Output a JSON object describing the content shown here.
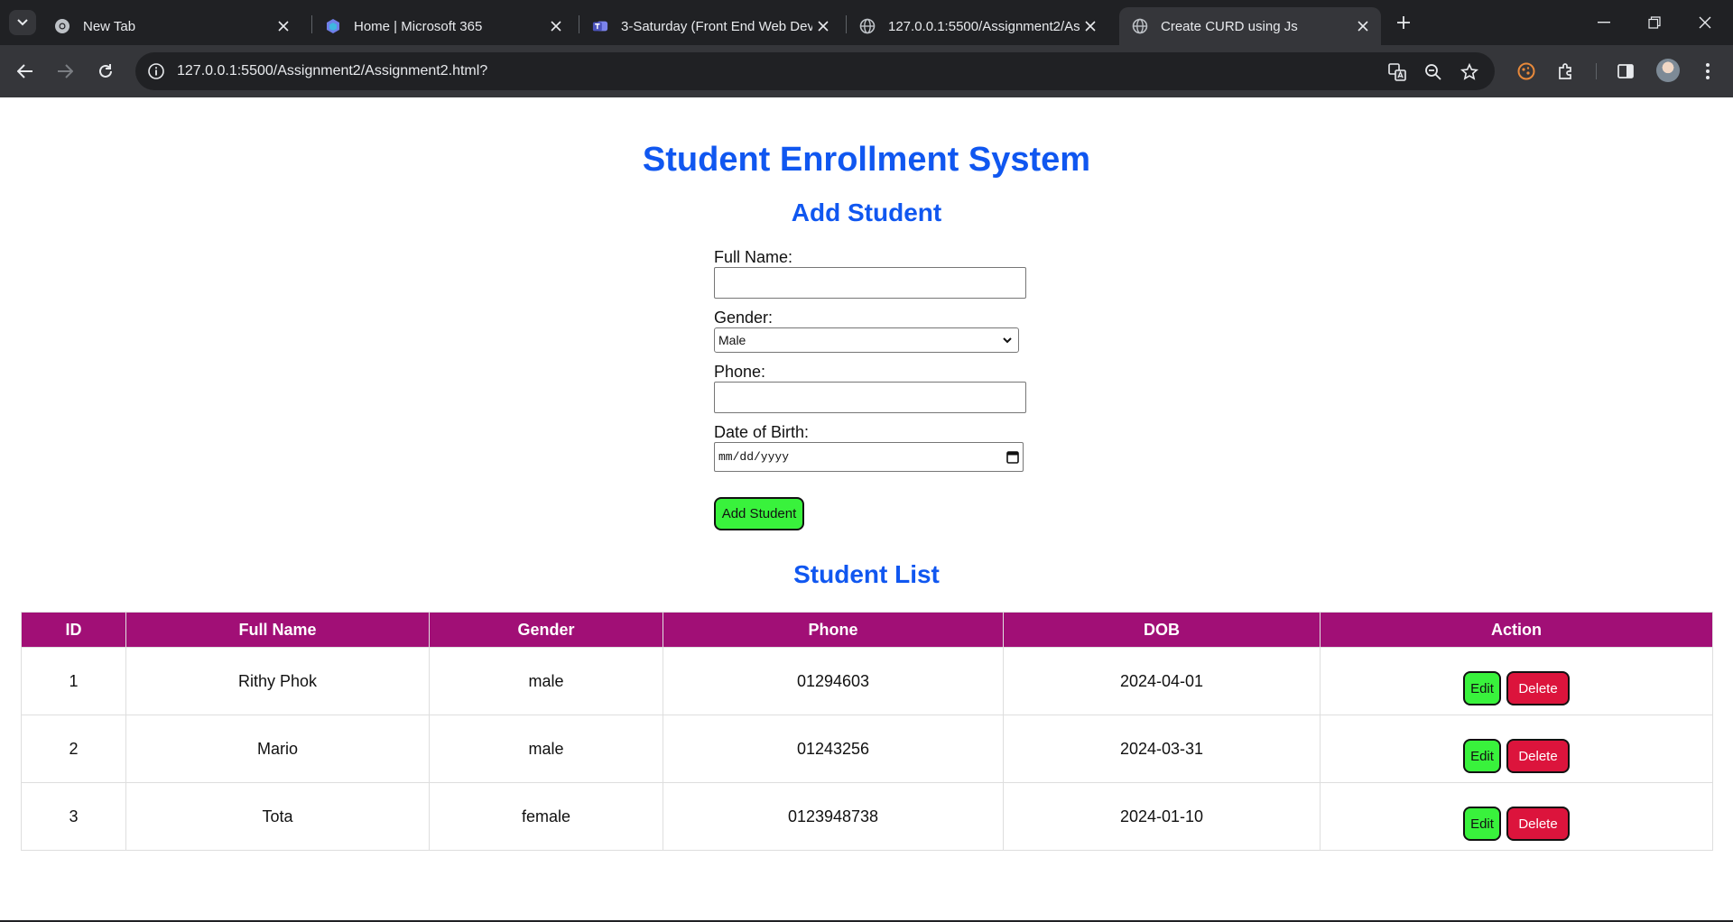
{
  "browser": {
    "tabs": [
      {
        "title": "New Tab",
        "favicon": "chrome-icon"
      },
      {
        "title": "Home | Microsoft 365",
        "favicon": "microsoft365-icon"
      },
      {
        "title": "3-Saturday (Front End Web Dev",
        "favicon": "teams-icon"
      },
      {
        "title": "127.0.0.1:5500/Assignment2/As",
        "favicon": "globe-icon"
      },
      {
        "title": "Create CURD using Js",
        "favicon": "globe-icon",
        "active": true
      }
    ],
    "url": "127.0.0.1:5500/Assignment2/Assignment2.html?"
  },
  "page": {
    "title": "Student Enrollment System",
    "form": {
      "heading": "Add Student",
      "full_name_label": "Full Name:",
      "full_name_value": "",
      "gender_label": "Gender:",
      "gender_value": "Male",
      "phone_label": "Phone:",
      "phone_value": "",
      "dob_label": "Date of Birth:",
      "dob_placeholder": "mm/dd/yyyy",
      "submit_label": "Add Student"
    },
    "list": {
      "heading": "Student List",
      "columns": [
        "ID",
        "Full Name",
        "Gender",
        "Phone",
        "DOB",
        "Action"
      ],
      "rows": [
        {
          "id": "1",
          "name": "Rithy Phok",
          "gender": "male",
          "phone": "01294603",
          "dob": "2024-04-01"
        },
        {
          "id": "2",
          "name": "Mario",
          "gender": "male",
          "phone": "01243256",
          "dob": "2024-03-31"
        },
        {
          "id": "3",
          "name": "Tota",
          "gender": "female",
          "phone": "0123948738",
          "dob": "2024-01-10"
        }
      ],
      "edit_label": "Edit",
      "delete_label": "Delete"
    }
  },
  "colors": {
    "heading_blue": "#1057f0",
    "table_header": "#a10f76",
    "edit_green": "#39f23c",
    "delete_red": "#dc143c"
  }
}
